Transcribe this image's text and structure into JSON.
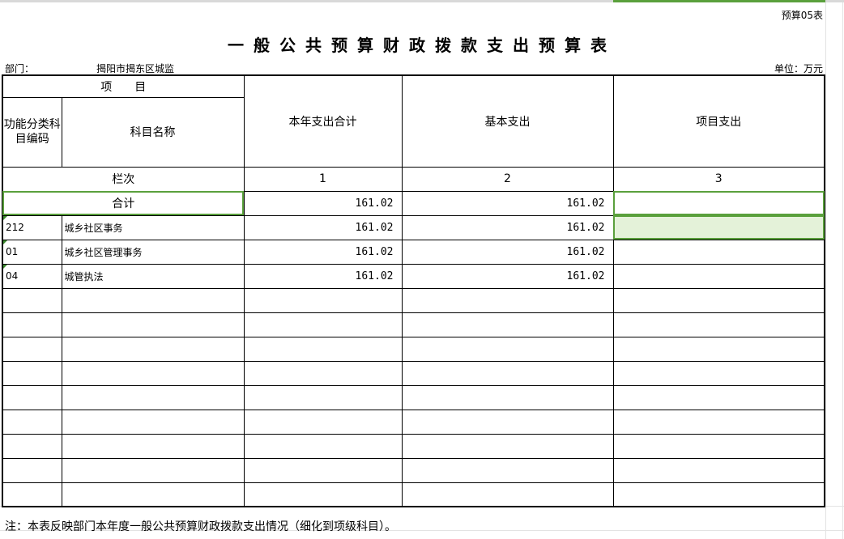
{
  "sheet": {
    "form_code": "预算05表",
    "title": "一般公共预算财政拨款支出预算表",
    "dept_label": "部门：",
    "dept_name": "揭阳市揭东区城监",
    "unit": "单位：万元",
    "header": {
      "item_group": "项　　目",
      "code": "功能分类科目编码",
      "name": "科目名称",
      "total": "本年支出合计",
      "basic": "基本支出",
      "project": "项目支出"
    },
    "column_index": {
      "label": "栏次",
      "cols": [
        "1",
        "2",
        "3"
      ]
    },
    "total_row": {
      "label": "合计",
      "total": "161.02",
      "basic": "161.02",
      "project": ""
    },
    "rows": [
      {
        "code": "212",
        "name": "城乡社区事务",
        "total": "161.02",
        "basic": "161.02",
        "project": ""
      },
      {
        "code": "01",
        "name": "城乡社区管理事务",
        "total": "161.02",
        "basic": "161.02",
        "project": ""
      },
      {
        "code": "04",
        "name": "城管执法",
        "total": "161.02",
        "basic": "161.02",
        "project": ""
      }
    ],
    "note": "注：本表反映部门本年度一般公共预算财政拨款支出情况（细化到项级科目）。",
    "accent_color": "#5aa03c"
  }
}
